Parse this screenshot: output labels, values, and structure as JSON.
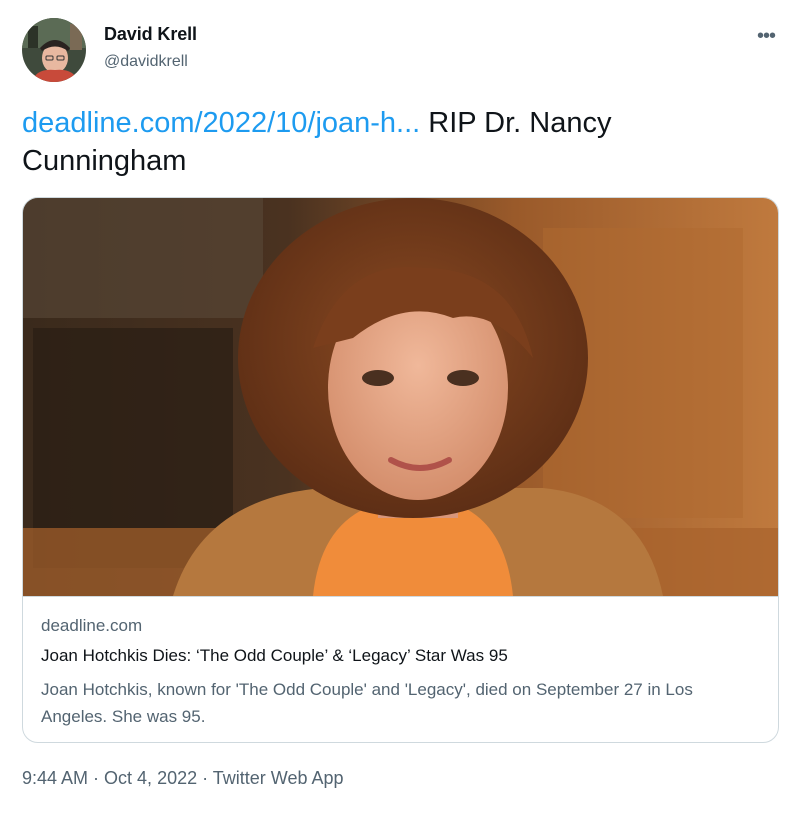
{
  "author": {
    "display_name": "David Krell",
    "handle": "@davidkrell"
  },
  "more_icon": "more-horizontal-icon",
  "tweet": {
    "link_text": "deadline.com/2022/10/joan-h...",
    "text": " RIP Dr. Nancy Cunningham"
  },
  "card": {
    "domain": "deadline.com",
    "title": "Joan Hotchkis Dies: ‘The Odd Couple’ & ‘Legacy’ Star Was 95",
    "description": "Joan Hotchkis, known for 'The Odd Couple' and 'Legacy', died on September 27 in Los Angeles. She was 95."
  },
  "meta": {
    "time": "9:44 AM",
    "separator": " · ",
    "date": "Oct 4, 2022",
    "source": "Twitter Web App"
  },
  "colors": {
    "link": "#1d9bf0",
    "secondary_text": "#536471",
    "border": "#cfd9de"
  }
}
